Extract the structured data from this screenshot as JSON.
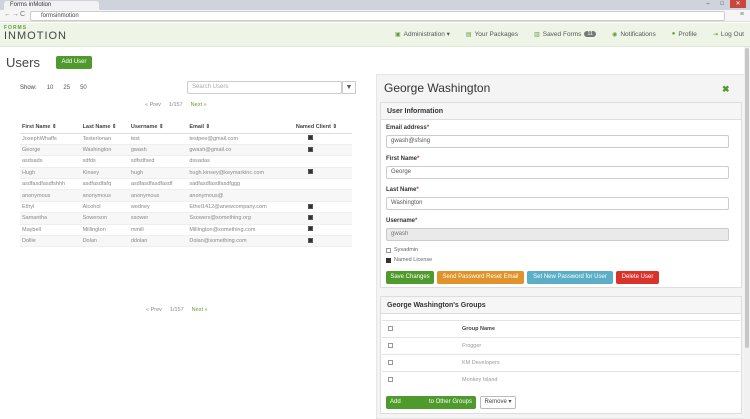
{
  "browser": {
    "tab_title": "Forms inMotion",
    "url": "formsinmotion",
    "back": "←",
    "forward": "→",
    "reload": "C",
    "minimize": "–",
    "maximize": "□",
    "close": "✕"
  },
  "header": {
    "logo_top": "FORMS",
    "logo_main": "INMOTION",
    "nav": [
      {
        "label": "Administration ▾",
        "icon": "briefcase-icon"
      },
      {
        "label": "Your Packages",
        "icon": "package-icon"
      },
      {
        "label": "Saved Forms",
        "icon": "save-icon",
        "badge": "11"
      },
      {
        "label": "Notifications",
        "icon": "bell-icon"
      },
      {
        "label": "Profile",
        "icon": "user-icon"
      },
      {
        "label": "Log Out",
        "icon": "logout-icon"
      }
    ]
  },
  "users": {
    "title": "Users",
    "add_button": "Add User",
    "show_label": "Show:",
    "show_options": [
      "10",
      "25",
      "50"
    ],
    "search_placeholder": "Search Users",
    "pager": {
      "prev": "« Prev",
      "info": "1/157",
      "next": "Next »"
    },
    "columns": [
      "First Name ⇕",
      "Last Name ⇕",
      "Username ⇕",
      "Email ⇕",
      "Named Client ⇕"
    ],
    "rows": [
      {
        "first": "JosephWhaffs",
        "last": "Testerlonan",
        "username": "test",
        "email": "testpee@gmail.com",
        "named": true
      },
      {
        "first": "George",
        "last": "Washington",
        "username": "gwash",
        "email": "gwash@gmail.co",
        "named": true
      },
      {
        "first": "asdsads",
        "last": "sdfds",
        "username": "sdfsdfsed",
        "email": "dssadas",
        "named": false
      },
      {
        "first": "Hugh",
        "last": "Kinsey",
        "username": "hugh",
        "email": "hugh.kinsey@keymarkinc.com",
        "named": true
      },
      {
        "first": "asdfasdfasdfshhh",
        "last": "asdfasdfafq",
        "username": "asdfasdfasdfasdf",
        "email": "sadfasdfasdfasdfggg",
        "named": false
      },
      {
        "first": "anonymous",
        "last": "anonymous",
        "username": "anonymous",
        "email": "anonymous@",
        "named": false
      },
      {
        "first": "Ethyl",
        "last": "Alcohol",
        "username": "wedney",
        "email": "Ethel1412@anewcompany.com",
        "named": true
      },
      {
        "first": "Samantha",
        "last": "Sowerson",
        "username": "ssower",
        "email": "Ssowers@something.org",
        "named": true
      },
      {
        "first": "Maybell",
        "last": "Millington",
        "username": "mmill",
        "email": "Millington@something.com",
        "named": true
      },
      {
        "first": "Dollie",
        "last": "Dolan",
        "username": "ddolan",
        "email": "Dolan@something.com",
        "named": true
      }
    ]
  },
  "detail": {
    "name": "George Washington",
    "close": "✖",
    "info_header": "User Information",
    "email_label": "Email address",
    "email_value": "gwash@sfsing",
    "first_label": "First Name",
    "first_value": "George",
    "last_label": "Last Name",
    "last_value": "Washington",
    "username_label": "Username",
    "username_value": "gwash",
    "required_mark": "*",
    "sysadmin_label": "Sysadmin",
    "named_license_label": "Named License",
    "buttons": {
      "save": "Save Changes",
      "reset": "Send Password Reset Email",
      "new_password": "Set New Password for User",
      "delete": "Delete User"
    },
    "colors": {
      "save": "#4f9a2d",
      "reset": "#e0932a",
      "new_password": "#5aaec6",
      "delete": "#d9342b"
    },
    "groups_header": "George Washington's Groups",
    "group_column": "Group Name",
    "groups": [
      "Frogger",
      "KM Developers",
      "Monkey Island"
    ],
    "add_button": "Add",
    "add_suffix": "to Other Groups",
    "remove_button": "Remove ▾"
  }
}
